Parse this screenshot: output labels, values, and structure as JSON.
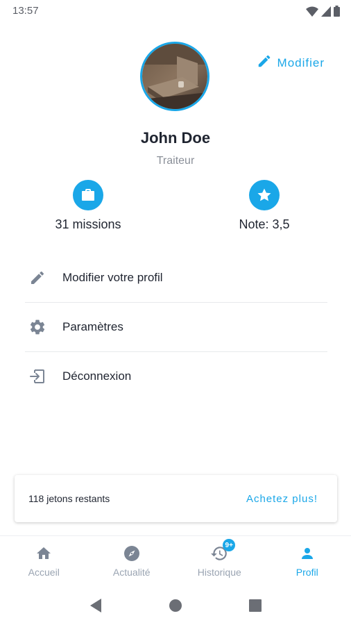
{
  "status_bar": {
    "time": "13:57",
    "icons": [
      "wifi-icon",
      "signal-icon",
      "battery-icon"
    ]
  },
  "profile": {
    "edit_label": "Modifier",
    "name": "John Doe",
    "role": "Traiteur",
    "avatar": "avatar-photo"
  },
  "stats": {
    "missions": {
      "label": "31 missions",
      "icon": "briefcase-icon"
    },
    "rating": {
      "label": "Note: 3,5",
      "icon": "star-icon"
    }
  },
  "menu": {
    "items": [
      {
        "label": "Modifier votre profil",
        "icon": "pencil-icon"
      },
      {
        "label": "Paramètres",
        "icon": "gear-icon"
      },
      {
        "label": "Déconnexion",
        "icon": "logout-icon"
      }
    ]
  },
  "tokens": {
    "remaining": "118 jetons restants",
    "buy_label": "Achetez plus!"
  },
  "bottom_nav": {
    "items": [
      {
        "label": "Accueil",
        "icon": "home-icon"
      },
      {
        "label": "Actualité",
        "icon": "compass-icon"
      },
      {
        "label": "Historique",
        "icon": "history-icon",
        "badge": "9+"
      },
      {
        "label": "Profil",
        "icon": "person-icon",
        "active": true
      }
    ]
  },
  "colors": {
    "accent": "#1aa7e8",
    "text": "#1f2430",
    "muted": "#8a8f98",
    "icon_gray": "#7b8594",
    "nav_inactive": "#9aa4b2"
  }
}
